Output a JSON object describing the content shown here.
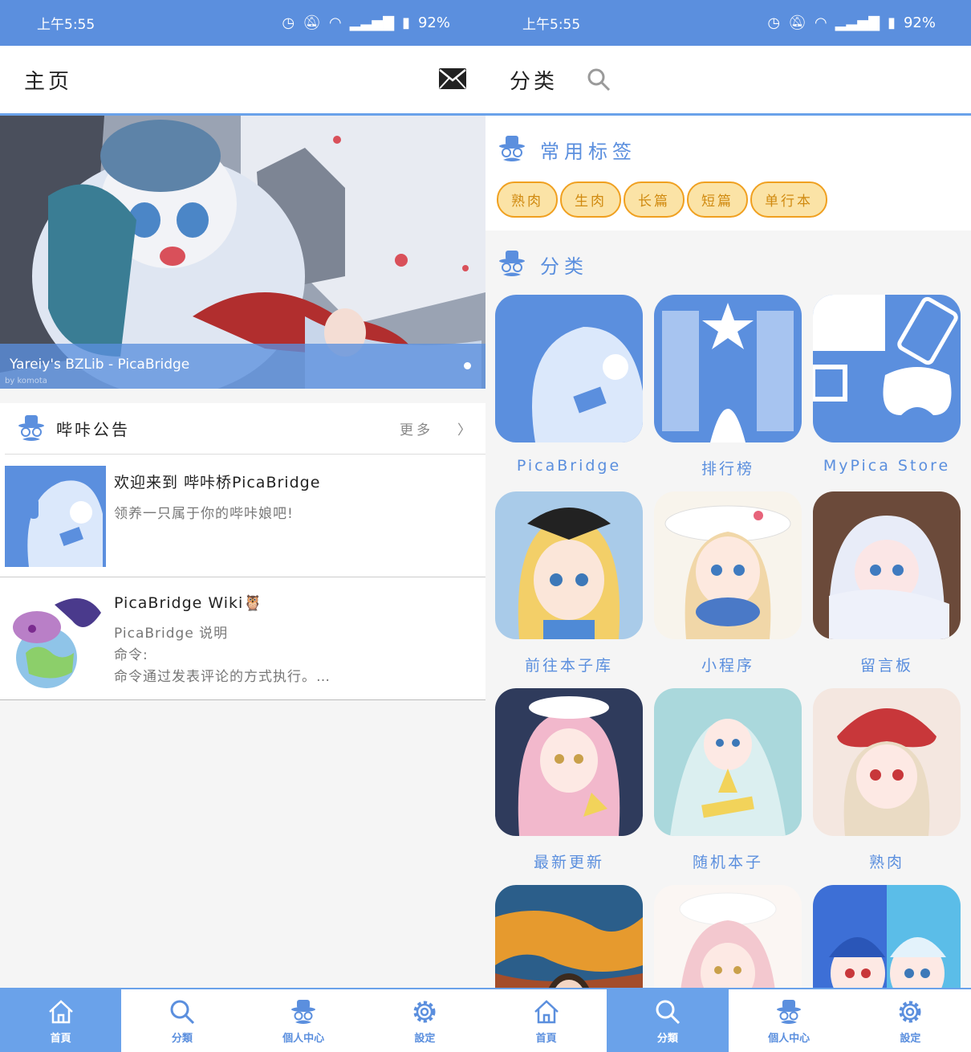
{
  "status": {
    "time": "上午5:55",
    "battery": "92%"
  },
  "left": {
    "title": "主页",
    "banner": {
      "caption": "Yareiy's BZLib - PicaBridge",
      "credit": "by komota"
    },
    "notice": {
      "title": "哔咔公告",
      "more": "更多",
      "items": [
        {
          "title": "欢迎来到 哔咔桥PicaBridge",
          "desc": "领养一只属于你的哔咔娘吧!"
        },
        {
          "title": "PicaBridge Wiki🦉",
          "desc": "PicaBridge 说明\n命令:\n命令通过发表评论的方式执行。…"
        }
      ]
    }
  },
  "right": {
    "title": "分类",
    "common_tags_title": "常用标签",
    "tags": [
      "熟肉",
      "生肉",
      "长篇",
      "短篇",
      "单行本"
    ],
    "categories_title": "分类",
    "categories": [
      "PicaBridge",
      "排行榜",
      "MyPica Store",
      "前往本子库",
      "小程序",
      "留言板",
      "最新更新",
      "随机本子",
      "熟肉",
      "",
      "",
      ""
    ]
  },
  "nav": {
    "home": "首頁",
    "category": "分類",
    "profile": "個人中心",
    "settings": "設定"
  },
  "colors": {
    "accent": "#5b8fde",
    "tag_bg": "#fbe3a6",
    "tag_border": "#f0a020"
  }
}
